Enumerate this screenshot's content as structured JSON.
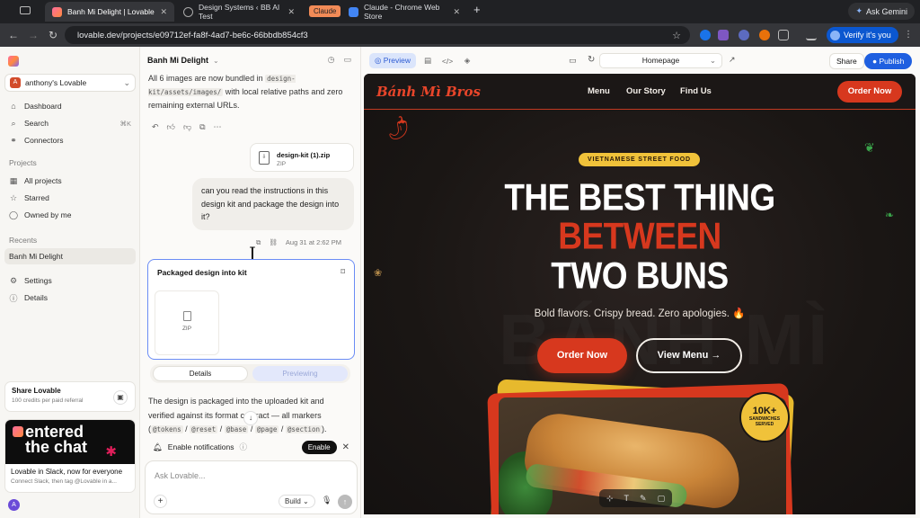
{
  "browser": {
    "tabs": [
      {
        "title": "Banh Mi Delight | Lovable",
        "active": true
      },
      {
        "title": "Design Systems ‹ BB AI Test"
      },
      {
        "group_label": "Claude"
      },
      {
        "title": "Claude - Chrome Web Store"
      }
    ],
    "ask_gemini": "Ask Gemini",
    "url": "lovable.dev/projects/e09712ef-fa8f-4ad7-be6c-66bbdb854cf3",
    "verify_label": "Verify it's you"
  },
  "sidebar": {
    "workspace_initial": "A",
    "workspace": "anthony's Lovable",
    "nav": [
      {
        "label": "Dashboard",
        "icon": "home-icon"
      },
      {
        "label": "Search",
        "icon": "search-icon",
        "shortcut": "⌘K"
      },
      {
        "label": "Connectors",
        "icon": "connectors-icon"
      }
    ],
    "projects_heading": "Projects",
    "projects": [
      {
        "label": "All projects",
        "icon": "grid-icon"
      },
      {
        "label": "Starred",
        "icon": "star-icon"
      },
      {
        "label": "Owned by me",
        "icon": "user-icon"
      }
    ],
    "recents_heading": "Recents",
    "recent_item": "Banh Mi Delight",
    "footer_nav": [
      {
        "label": "Settings",
        "icon": "gear-icon"
      },
      {
        "label": "Details",
        "icon": "info-icon"
      }
    ],
    "share_card": {
      "title": "Share Lovable",
      "subtitle": "100 credits per paid referral"
    },
    "promo": {
      "art_line1": "entered",
      "art_line2": "the chat",
      "title": "Lovable in Slack, now for everyone",
      "subtitle": "Connect Slack, then tag @Lovable in a..."
    },
    "user_initial": "A"
  },
  "chat": {
    "project_title": "Banh Mi Delight",
    "intro_text_1": "All 6 images are now bundled in ",
    "intro_code_1": "design-kit/assets/images/",
    "intro_text_2": " with local relative paths and zero remaining external URLs.",
    "attachment": {
      "name": "design-kit (1).zip",
      "kind": "ZIP"
    },
    "user_message": "can you read the instructions in this design kit and package the design into it?",
    "timestamp": "Aug 31 at 2:62 PM",
    "artifact": {
      "title": "Packaged design into kit",
      "file_kind": "ZIP"
    },
    "tabs": {
      "details": "Details",
      "previewing": "Previewing"
    },
    "reply_text_1": "The design is packaged into the uploaded kit and verified against its format contract — all markers (",
    "reply_codes": [
      "@tokens",
      "@reset",
      "@base",
      "@page",
      "@section"
    ],
    "reply_text_2": ").",
    "notification": {
      "label": "Enable notifications",
      "button": "Enable"
    },
    "composer": {
      "placeholder": "Ask Lovable...",
      "mode": "Build"
    }
  },
  "preview_bar": {
    "preview_tab": "Preview",
    "route": "Homepage",
    "share": "Share",
    "publish": "Publish"
  },
  "site": {
    "logo": "Bánh Mì Bros",
    "nav": [
      "Menu",
      "Our Story",
      "Find Us"
    ],
    "order_now": "Order Now",
    "tagline": "VIETNAMESE STREET FOOD",
    "headline": [
      "THE BEST THING",
      "BETWEEN",
      "TWO BUNS"
    ],
    "subtitle": "Bold flavors. Crispy bread. Zero apologies. 🔥",
    "cta_primary": "Order Now",
    "cta_secondary": "View Menu →",
    "watermark": "BÁNH MÌ",
    "badge": {
      "number": "10K+",
      "label_1": "SANDWICHES",
      "label_2": "SERVED"
    },
    "colors": {
      "brand_red": "#d7381e",
      "brand_yellow": "#f0c23a",
      "bg_dark": "#1a1614"
    }
  }
}
